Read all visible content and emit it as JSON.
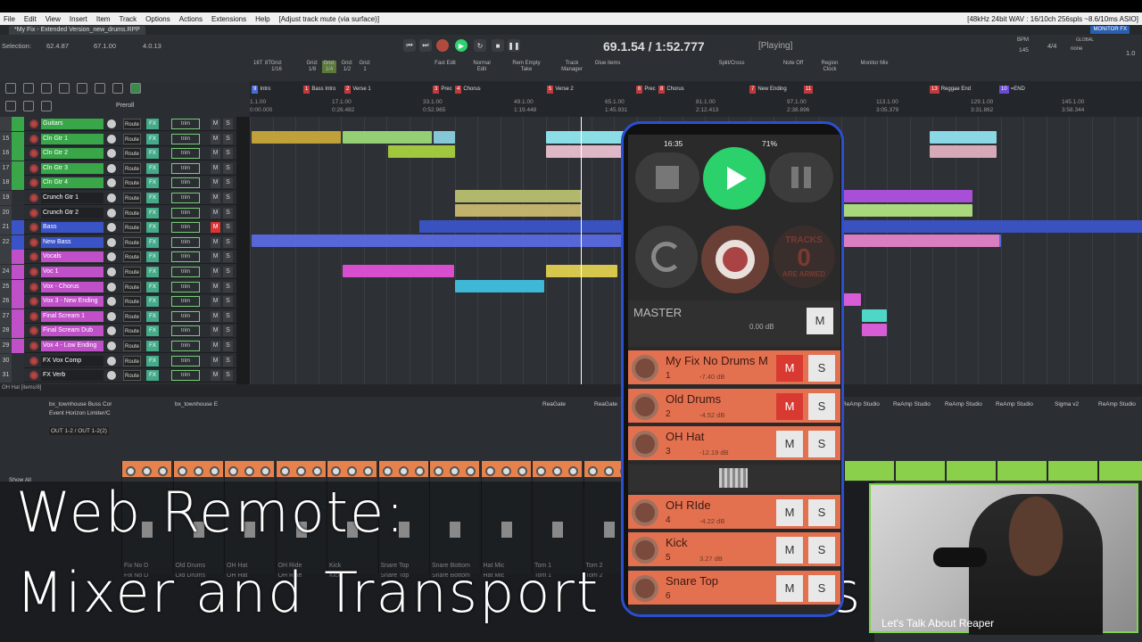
{
  "menubar": {
    "items": [
      "File",
      "Edit",
      "View",
      "Insert",
      "Item",
      "Track",
      "Options",
      "Actions",
      "Extensions",
      "Help"
    ],
    "action_hint": "[Adjust track mute (via surface)]",
    "audio_status": "[48kHz 24bit WAV : 16/10ch 256spls ~8.6/10ms ASIO]"
  },
  "tab": {
    "title": "*My Fix - Extended Version_new_drums.RPP",
    "monitor_fx": "MONITOR FX"
  },
  "selection": {
    "label": "Selection:",
    "start": "62.4.87",
    "end": "67.1.00",
    "length": "4.0.13"
  },
  "transport": {
    "position": "69.1.54 / 1:52.777",
    "state": "[Playing]",
    "bpm_label": "BPM",
    "bpm": "145",
    "timesig": "4/4",
    "global_label": "GLOBAL",
    "global_value": "none",
    "rate": "1.0"
  },
  "toolbar_labels": [
    "16T",
    "8T",
    "Grid: 1/16",
    "Grid: 1/8",
    "Grid: 1/4",
    "Grid: 1/2",
    "Grid: 1",
    "Fast Edit",
    "Normal Edit",
    "Rem Empty Take",
    "Track Manager",
    "Glue items",
    "Split/Cross",
    "Note Off",
    "Region Clock",
    "Monitor Mix"
  ],
  "preroll": "Preroll",
  "markers": [
    {
      "num": "9",
      "name": "Intro"
    },
    {
      "num": "1",
      "name": "Bass Intro"
    },
    {
      "num": "2",
      "name": "Verse 1"
    },
    {
      "num": "3",
      "name": "Prec"
    },
    {
      "num": "4",
      "name": "Chorus"
    },
    {
      "num": "5",
      "name": "Verse 2"
    },
    {
      "num": "6",
      "name": "Prec"
    },
    {
      "num": "8",
      "name": "Chorus"
    },
    {
      "num": "7",
      "name": "New Ending"
    },
    {
      "num": "11",
      "name": ""
    },
    {
      "num": "13",
      "name": "Reggae End"
    },
    {
      "num": "10",
      "name": "=END"
    }
  ],
  "ruler_ticks": [
    "1.1.00",
    "17.1.00",
    "33.1.00",
    "49.1.00",
    "65.1.00",
    "81.1.00",
    "97.1.00",
    "113.1.00",
    "129.1.00",
    "145.1.00"
  ],
  "ruler_times": [
    "0:00.000",
    "0:26.482",
    "0:52.965",
    "1:19.448",
    "1:45.931",
    "2:12.413",
    "2:38.896",
    "3:05.379",
    "3:31.862",
    "3:58.344"
  ],
  "tracks": [
    {
      "num": "",
      "name": "Guitars",
      "color": "#3aa64a"
    },
    {
      "num": "15",
      "name": "Cln Gtr 1",
      "color": "#3aa64a"
    },
    {
      "num": "16",
      "name": "Cln Gtr 2",
      "color": "#3aa64a"
    },
    {
      "num": "17",
      "name": "Cln Gtr 3",
      "color": "#3aa64a"
    },
    {
      "num": "18",
      "name": "Cln Gtr 4",
      "color": "#3aa64a"
    },
    {
      "num": "19",
      "name": "Crunch Gtr 1",
      "color": "#2c2f33"
    },
    {
      "num": "20",
      "name": "Crunch Gtr 2",
      "color": "#2c2f33"
    },
    {
      "num": "21",
      "name": "Bass",
      "color": "#3a54c8",
      "mute": true
    },
    {
      "num": "22",
      "name": "New Bass",
      "color": "#3a54c8"
    },
    {
      "num": "",
      "name": "Vocals",
      "color": "#c050c8"
    },
    {
      "num": "24",
      "name": "Voc 1",
      "color": "#c050c8"
    },
    {
      "num": "25",
      "name": "Vox - Chorus",
      "color": "#c050c8"
    },
    {
      "num": "26",
      "name": "Vox 3 - New Ending",
      "color": "#c050c8"
    },
    {
      "num": "27",
      "name": "Final Scream 1",
      "color": "#c050c8"
    },
    {
      "num": "28",
      "name": "Final Scream Dub",
      "color": "#c050c8"
    },
    {
      "num": "29",
      "name": "Vox 4 - Low Ending",
      "color": "#c050c8"
    },
    {
      "num": "30",
      "name": "FX Vox Comp",
      "color": "#2c2f33"
    },
    {
      "num": "31",
      "name": "FX Verb",
      "color": "#2c2f33"
    }
  ],
  "tcp_labels": {
    "route": "Route",
    "fx": "FX",
    "trim": "trim",
    "m": "M",
    "s": "S"
  },
  "mixer": {
    "fx_labels": [
      "bx_townhouse Buss Cor",
      "Event Horizon Limiter/C",
      "bx_townhouse E",
      "ReaGate",
      "ReaGate",
      "ReAmp Studio",
      "ReAmp Studio",
      "ReAmp Studio",
      "ReAmp Studio",
      "Sigma v2",
      "ReAmp Studio"
    ],
    "out_label": "OUT 1-2 / OUT 1-2(2)",
    "show_all": "Show All",
    "track_hint": "OH Hat [items/8]",
    "strip_names": [
      "Fix No D",
      "Old Drums",
      "OH Hat",
      "OH Ride",
      "Kick",
      "Snare Top",
      "Snare Bottom",
      "Hat Mic",
      "Tom 1",
      "Tom 2"
    ]
  },
  "overlay": {
    "line1": "Web Remote:",
    "line2": "Mixer and Transport Controls"
  },
  "webcam_caption": "Let's Talk About Reaper",
  "phone": {
    "clock": "16:35",
    "battery": "71%",
    "armed_top": "TRACKS",
    "armed_count": "0",
    "armed_bottom": "ARE ARMED",
    "master_name": "MASTER",
    "master_db": "0.00 dB",
    "m_label": "M",
    "s_label": "S",
    "tracks": [
      {
        "name": "My Fix No Drums M",
        "num": "1",
        "db": "-7.40 dB",
        "mute": true
      },
      {
        "name": "Old Drums",
        "num": "2",
        "db": "-4.52 dB",
        "mute": true
      },
      {
        "name": "OH Hat",
        "num": "3",
        "db": "-12.19 dB",
        "mute": false
      },
      {
        "name": "OH RIde",
        "num": "4",
        "db": "-4.22 dB",
        "mute": false
      },
      {
        "name": "Kick",
        "num": "5",
        "db": "3.27 dB",
        "mute": false
      },
      {
        "name": "Snare Top",
        "num": "6",
        "db": "",
        "mute": false
      }
    ]
  }
}
